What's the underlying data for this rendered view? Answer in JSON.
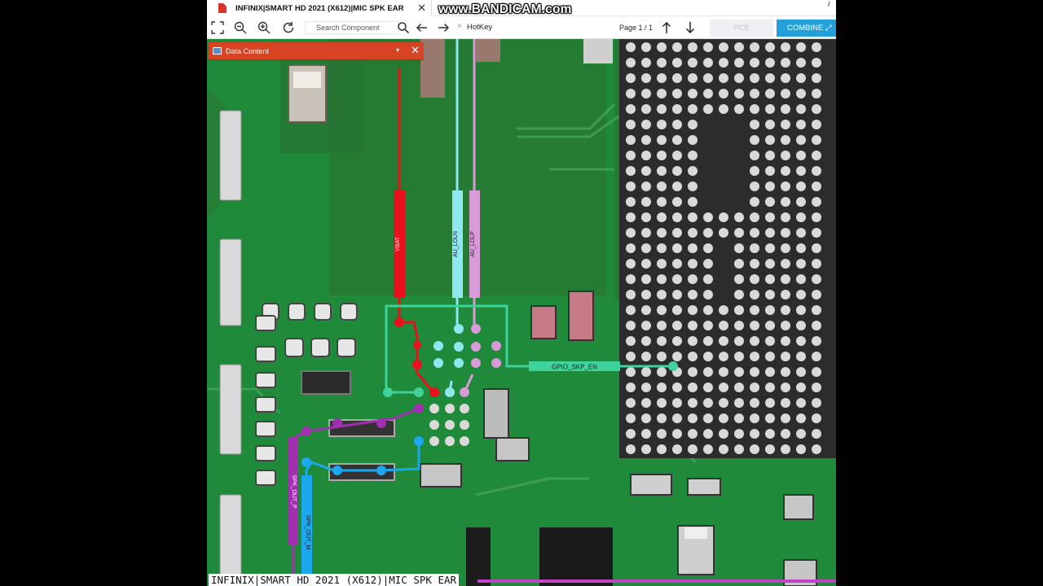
{
  "tab": {
    "title": "INFINIX|SMART HD 2021 (X612)|MIC SPK EAR",
    "close": "✕"
  },
  "watermark": "www.BANDICAM.com",
  "toolbar": {
    "search_placeholder": "Search Component",
    "hotkey_label": "HotKey",
    "page_indicator": "Page 1 / 1",
    "pcb_label": "PCB",
    "combine_label": "COMBINE"
  },
  "panel": {
    "title": "Data Content",
    "chevron": "▾",
    "close": "✕"
  },
  "nets": [
    {
      "name": "VBAT",
      "color": "#e8101b"
    },
    {
      "name": "AU_LOLN",
      "color": "#8fe7ef"
    },
    {
      "name": "AU_LOLP",
      "color": "#d99ad8"
    },
    {
      "name": "GPIO_SKP_EN",
      "color": "#3fd29a"
    },
    {
      "name": "SPK_OUT_P",
      "color": "#a12fb0"
    },
    {
      "name": "SPK_OUT_M",
      "color": "#1ba8ee"
    }
  ],
  "caption": "INFINIX|SMART HD 2021 (X612)|MIC SPK EAR",
  "icons": [
    "pdf-file-icon",
    "fullscreen-icon",
    "zoom-out-icon",
    "zoom-in-icon",
    "refresh-icon",
    "search-icon",
    "arrow-left-icon",
    "arrow-right-icon",
    "arrow-up-icon",
    "arrow-down-icon",
    "expand-icon"
  ]
}
